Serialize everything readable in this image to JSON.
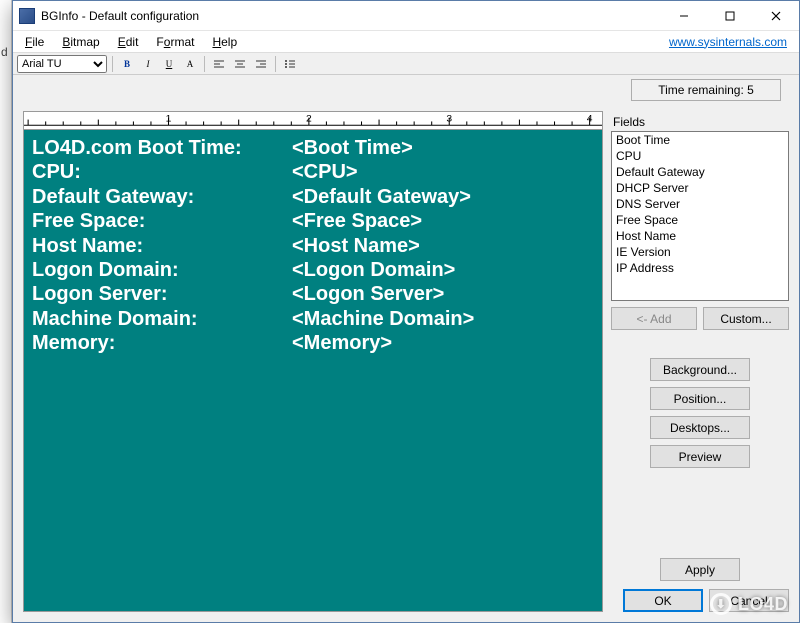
{
  "window": {
    "title": "BGInfo - Default configuration"
  },
  "menu": {
    "file": "File",
    "bitmap": "Bitmap",
    "edit": "Edit",
    "format": "Format",
    "help": "Help",
    "link": "www.sysinternals.com"
  },
  "toolbar": {
    "font": "Arial TU"
  },
  "timer": {
    "label": "Time remaining: 5"
  },
  "editor": {
    "rows": [
      {
        "label": "LO4D.com Boot Time:",
        "value": "<Boot Time>"
      },
      {
        "label": "CPU:",
        "value": "<CPU>"
      },
      {
        "label": "Default Gateway:",
        "value": "<Default Gateway>"
      },
      {
        "label": "Free Space:",
        "value": "<Free Space>"
      },
      {
        "label": "Host Name:",
        "value": "<Host Name>"
      },
      {
        "label": "Logon Domain:",
        "value": "<Logon Domain>"
      },
      {
        "label": "Logon Server:",
        "value": "<Logon Server>"
      },
      {
        "label": "Machine Domain:",
        "value": "<Machine Domain>"
      },
      {
        "label": "Memory:",
        "value": "<Memory>"
      }
    ]
  },
  "fields": {
    "label": "Fields",
    "items": [
      "Boot Time",
      "CPU",
      "Default Gateway",
      "DHCP Server",
      "DNS Server",
      "Free Space",
      "Host Name",
      "IE Version",
      "IP Address"
    ]
  },
  "buttons": {
    "add": "<- Add",
    "custom": "Custom...",
    "background": "Background...",
    "position": "Position...",
    "desktops": "Desktops...",
    "preview": "Preview",
    "apply": "Apply",
    "ok": "OK",
    "cancel": "Cancel"
  },
  "watermark": "LO4D"
}
